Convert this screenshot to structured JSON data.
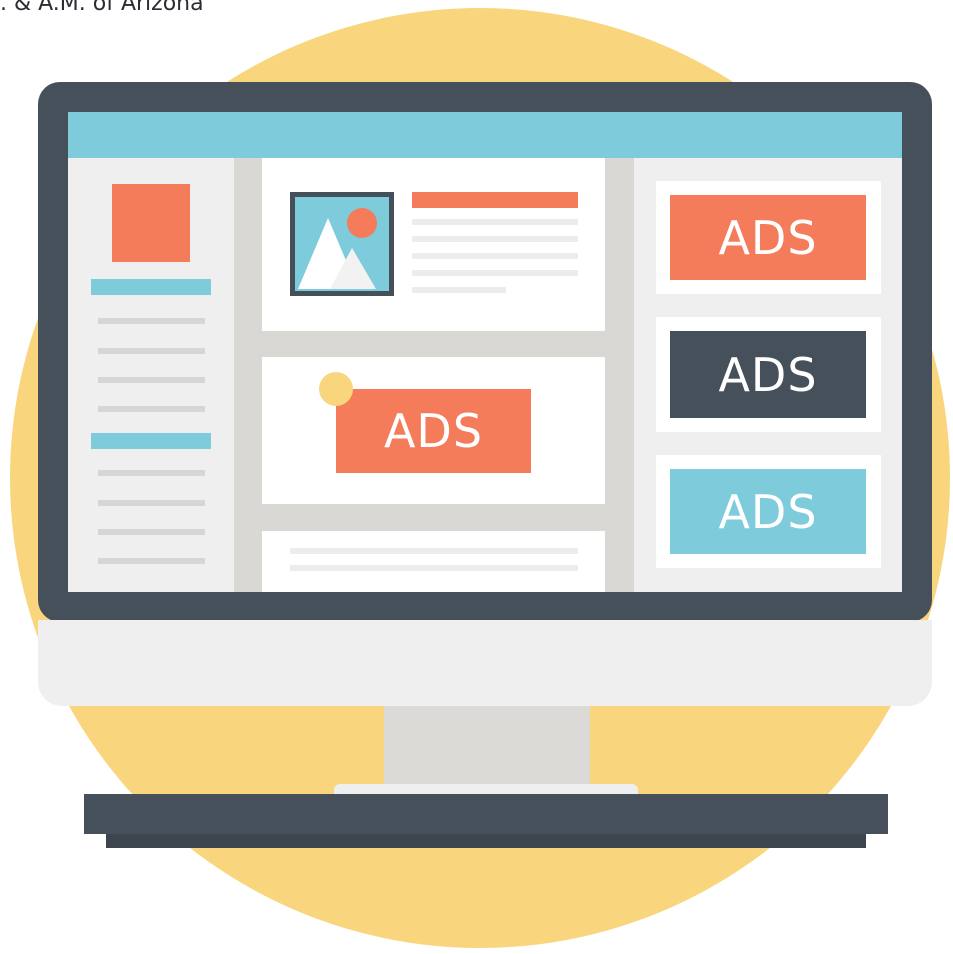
{
  "caption": ". & A.M. of Arizona",
  "ads": {
    "center_label": "ADS",
    "right_top_label": "ADS",
    "right_middle_label": "ADS",
    "right_bottom_label": "ADS"
  },
  "colors": {
    "circle": "#f9d57e",
    "frame": "#46505a",
    "chin": "#efefef",
    "neck": "#dcdad7",
    "base": "#46505a",
    "topbar": "#7ecbdc",
    "screen_bg": "#efefef",
    "gutter": "#d9d8d4",
    "orange": "#f47c5b",
    "dark": "#46505a",
    "blue": "#7ecbdc",
    "yellow_dot": "#f9d57e",
    "line_gray": "#d6d6d6"
  },
  "icons": [
    "image-icon",
    "mountain-icon",
    "sun-icon"
  ]
}
